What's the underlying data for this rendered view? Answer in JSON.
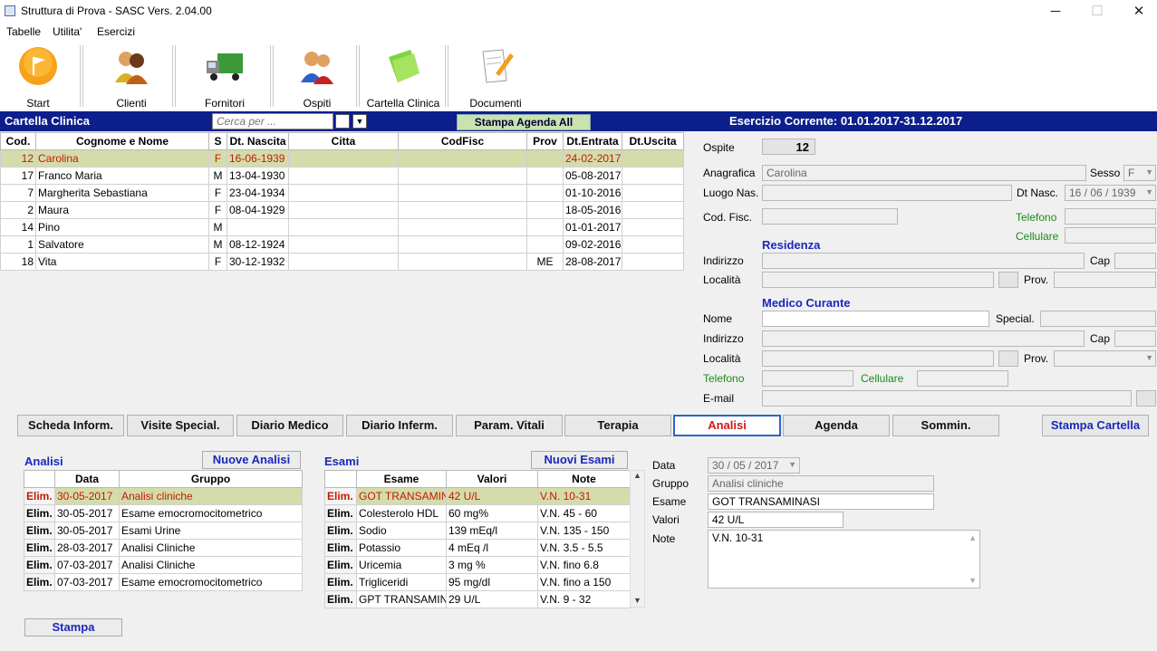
{
  "window": {
    "title": "Struttura di Prova - SASC Vers. 2.04.00",
    "minimize": "─",
    "maximize": "☐",
    "close": "✕"
  },
  "menu": [
    "Tabelle",
    "Utilita'",
    "Esercizi"
  ],
  "toolbar": [
    {
      "label": "Start",
      "icon": "start-flag-icon"
    },
    {
      "label": "Clienti",
      "icon": "clients-people-icon"
    },
    {
      "label": "Fornitori",
      "icon": "supplier-truck-icon"
    },
    {
      "label": "Ospiti",
      "icon": "guests-people-icon"
    },
    {
      "label": "Cartella Clinica",
      "icon": "green-folder-icon"
    },
    {
      "label": "Documenti",
      "icon": "document-pencil-icon"
    }
  ],
  "header": {
    "section_title": "Cartella Clinica",
    "search_placeholder": "Cerca per ...",
    "stampa_agenda": "Stampa Agenda All",
    "esercizio": "Esercizio Corrente: 01.01.2017-31.12.2017"
  },
  "patients": {
    "columns": [
      "Cod.",
      "Cognome e Nome",
      "S",
      "Dt. Nascita",
      "Citta",
      "CodFisc",
      "Prov",
      "Dt.Entrata",
      "Dt.Uscita"
    ],
    "rows": [
      [
        "12",
        "Carolina",
        "F",
        "16-06-1939",
        "",
        "",
        "",
        "24-02-2017",
        ""
      ],
      [
        "17",
        "Franco Maria",
        "M",
        "13-04-1930",
        "",
        "",
        "",
        "05-08-2017",
        ""
      ],
      [
        "7",
        "Margherita Sebastiana",
        "F",
        "23-04-1934",
        "",
        "",
        "",
        "01-10-2016",
        ""
      ],
      [
        "2",
        "Maura",
        "F",
        "08-04-1929",
        "",
        "",
        "",
        "18-05-2016",
        ""
      ],
      [
        "14",
        "Pino",
        "M",
        "",
        "",
        "",
        "",
        "01-01-2017",
        ""
      ],
      [
        "1",
        "Salvatore",
        "M",
        "08-12-1924",
        "",
        "",
        "",
        "09-02-2016",
        ""
      ],
      [
        "18",
        "Vita",
        "F",
        "30-12-1932",
        "",
        "",
        "ME",
        "28-08-2017",
        ""
      ]
    ]
  },
  "detail": {
    "ospite_label": "Ospite",
    "ospite_value": "12",
    "anagrafica_label": "Anagrafica",
    "anagrafica_value": "Carolina",
    "sesso_label": "Sesso",
    "sesso_value": "F",
    "luogo_label": "Luogo Nas.",
    "dtnasc_label": "Dt Nasc.",
    "dtnasc_value": "16 / 06 / 1939",
    "codfisc_label": "Cod. Fisc.",
    "telefono_label": "Telefono",
    "cellulare_label": "Cellulare",
    "residenza_title": "Residenza",
    "indirizzo_label": "Indirizzo",
    "cap_label": "Cap",
    "localita_label": "Località",
    "prov_label": "Prov.",
    "medico_title": "Medico Curante",
    "nome_label": "Nome",
    "special_label": "Special.",
    "indirizzo2_label": "Indirizzo",
    "cap2_label": "Cap",
    "localita2_label": "Località",
    "prov2_label": "Prov.",
    "telefono2_label": "Telefono",
    "cellulare2_label": "Cellulare",
    "email_label": "E-mail"
  },
  "tabs": [
    "Scheda Inform.",
    "Visite Special.",
    "Diario Medico",
    "Diario Inferm.",
    "Param. Vitali",
    "Terapia",
    "Analisi",
    "Agenda",
    "Sommin."
  ],
  "active_tab": "Analisi",
  "stampa_cartella": "Stampa Cartella",
  "analisi": {
    "title": "Analisi",
    "new_button": "Nuove Analisi",
    "columns": [
      "",
      "Data",
      "Gruppo"
    ],
    "rows": [
      [
        "Elim.",
        "30-05-2017",
        "Analisi cliniche"
      ],
      [
        "Elim.",
        "30-05-2017",
        "Esame emocromocitometrico"
      ],
      [
        "Elim.",
        "30-05-2017",
        "Esami Urine"
      ],
      [
        "Elim.",
        "28-03-2017",
        "Analisi Cliniche"
      ],
      [
        "Elim.",
        "07-03-2017",
        "Analisi Cliniche"
      ],
      [
        "Elim.",
        "07-03-2017",
        "Esame emocromocitometrico"
      ]
    ],
    "stampa": "Stampa"
  },
  "esami": {
    "title": "Esami",
    "new_button": "Nuovi Esami",
    "columns": [
      "",
      "Esame",
      "Valori",
      "Note"
    ],
    "rows": [
      [
        "Elim.",
        "GOT TRANSAMIN",
        "42 U/L",
        "V.N. 10-31"
      ],
      [
        "Elim.",
        "Colesterolo HDL",
        "60 mg%",
        "V.N. 45 - 60"
      ],
      [
        "Elim.",
        "Sodio",
        "139 mEq/l",
        "V.N. 135 - 150"
      ],
      [
        "Elim.",
        "Potassio",
        "4 mEq /l",
        "V.N. 3.5 - 5.5"
      ],
      [
        "Elim.",
        "Uricemia",
        "3 mg %",
        "V.N. fino  6.8"
      ],
      [
        "Elim.",
        "Trigliceridi",
        "95 mg/dl",
        "V.N. fino a 150"
      ],
      [
        "Elim.",
        "GPT TRANSAMIN",
        "29  U/L",
        "V.N. 9 - 32"
      ]
    ]
  },
  "esame_detail": {
    "data_label": "Data",
    "data_value": "30 / 05 / 2017",
    "gruppo_label": "Gruppo",
    "gruppo_value": "Analisi cliniche",
    "esame_label": "Esame",
    "esame_value": "GOT TRANSAMINASI",
    "valori_label": "Valori",
    "valori_value": "42 U/L",
    "note_label": "Note",
    "note_value": "V.N. 10-31"
  },
  "colors": {
    "header_blue": "#0c1f8c",
    "selected_row": "#d4dcac",
    "selected_text": "#c41a00",
    "section_blue": "#1a28b8",
    "green_label": "#1a8a1a"
  }
}
